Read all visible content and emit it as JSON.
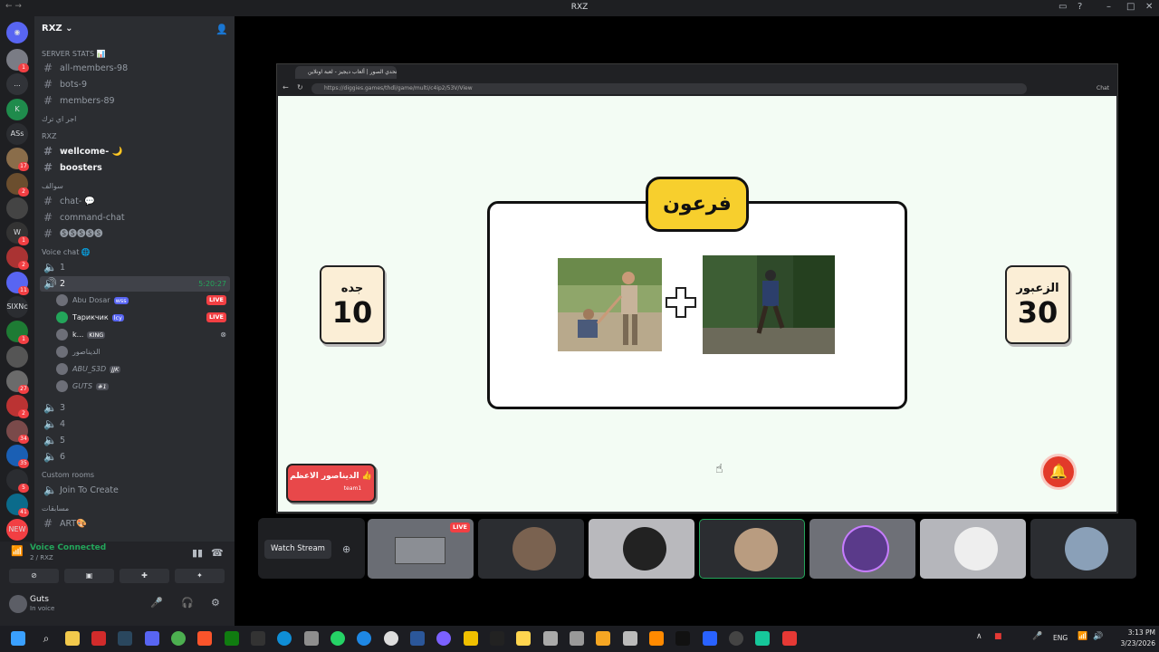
{
  "window": {
    "title": "RXZ"
  },
  "server": {
    "name": "RXZ"
  },
  "rail": {
    "items": [
      {
        "label": "",
        "badge": "1"
      },
      {
        "label": "...",
        "badge": ""
      },
      {
        "label": "K",
        "badge": ""
      },
      {
        "label": "ASs",
        "badge": ""
      },
      {
        "label": "",
        "badge": "17"
      },
      {
        "label": "",
        "badge": "2"
      },
      {
        "label": "",
        "badge": ""
      },
      {
        "label": "W",
        "badge": "1"
      },
      {
        "label": "",
        "badge": "2"
      },
      {
        "label": "",
        "badge": "11"
      },
      {
        "label": "SIXNc",
        "badge": ""
      },
      {
        "label": "",
        "badge": "1"
      },
      {
        "label": "",
        "badge": ""
      },
      {
        "label": "",
        "badge": "27"
      },
      {
        "label": "",
        "badge": "2"
      },
      {
        "label": "",
        "badge": "34"
      },
      {
        "label": "",
        "badge": "35"
      },
      {
        "label": "",
        "badge": "5"
      },
      {
        "label": "",
        "badge": "41"
      },
      {
        "label": "NEW",
        "badge": ""
      }
    ]
  },
  "sidebar": {
    "server_stats": "SERVER STATS 📊",
    "all_members": "all-members-98",
    "bots": "bots-9",
    "members": "members-89",
    "cat_1": "اجر اي ترك",
    "cat_rxz": "RXZ",
    "welcome": "wellcome- 🌙",
    "boosters": "boosters",
    "cat_chat": "سوالف",
    "chat": "chat- 💬",
    "command_chat": "command-chat",
    "special": "🅢🅢🅢🅢🅢",
    "voice_cat": "Voice chat 🌐",
    "vc1": "1",
    "vc2": "2",
    "vc2_time": "5:20:27",
    "users": [
      {
        "name": "Abu Dosar",
        "tag": "wss",
        "live": "LIVE"
      },
      {
        "name": "Тарикчик",
        "tag": "lcy",
        "live": "LIVE"
      },
      {
        "name": "k...",
        "tag": "KING",
        "live": ""
      },
      {
        "name": "الديناصور",
        "tag": "",
        "live": ""
      },
      {
        "name": "ABU_S3D",
        "tag": "JJK",
        "live": ""
      },
      {
        "name": "GUTS",
        "tag": "#1",
        "live": ""
      }
    ],
    "vc3": "3",
    "vc4": "4",
    "vc5": "5",
    "vc6": "6",
    "custom_rooms": "Custom rooms",
    "join_to_create": "Join To Create",
    "cat_last": "مسابقات",
    "art": "ART🎨"
  },
  "voice_panel": {
    "status": "Voice Connected",
    "sub": "2 / RXZ",
    "user_name": "Guts",
    "user_status": "In voice"
  },
  "browser": {
    "tab_title": "تحدي الصور | ألعاب ديجيز - لعبة اونلاين",
    "url": "https://diggies.games/thdl/game/multi/c4ip2/53V/View",
    "chat_label": "Chat"
  },
  "game": {
    "word": "فرعون",
    "left_team": {
      "name": "جده",
      "score": "10"
    },
    "right_team": {
      "name": "الزعبور",
      "score": "30"
    },
    "player_label": "الديناصور الاعظم 👍",
    "player_sub": "team1"
  },
  "stream": {
    "watch_label": "Watch Stream",
    "live_label": "LIVE"
  },
  "taskbar": {
    "lang": "ENG",
    "time": "3:13 PM",
    "date": "3/23/2026"
  }
}
